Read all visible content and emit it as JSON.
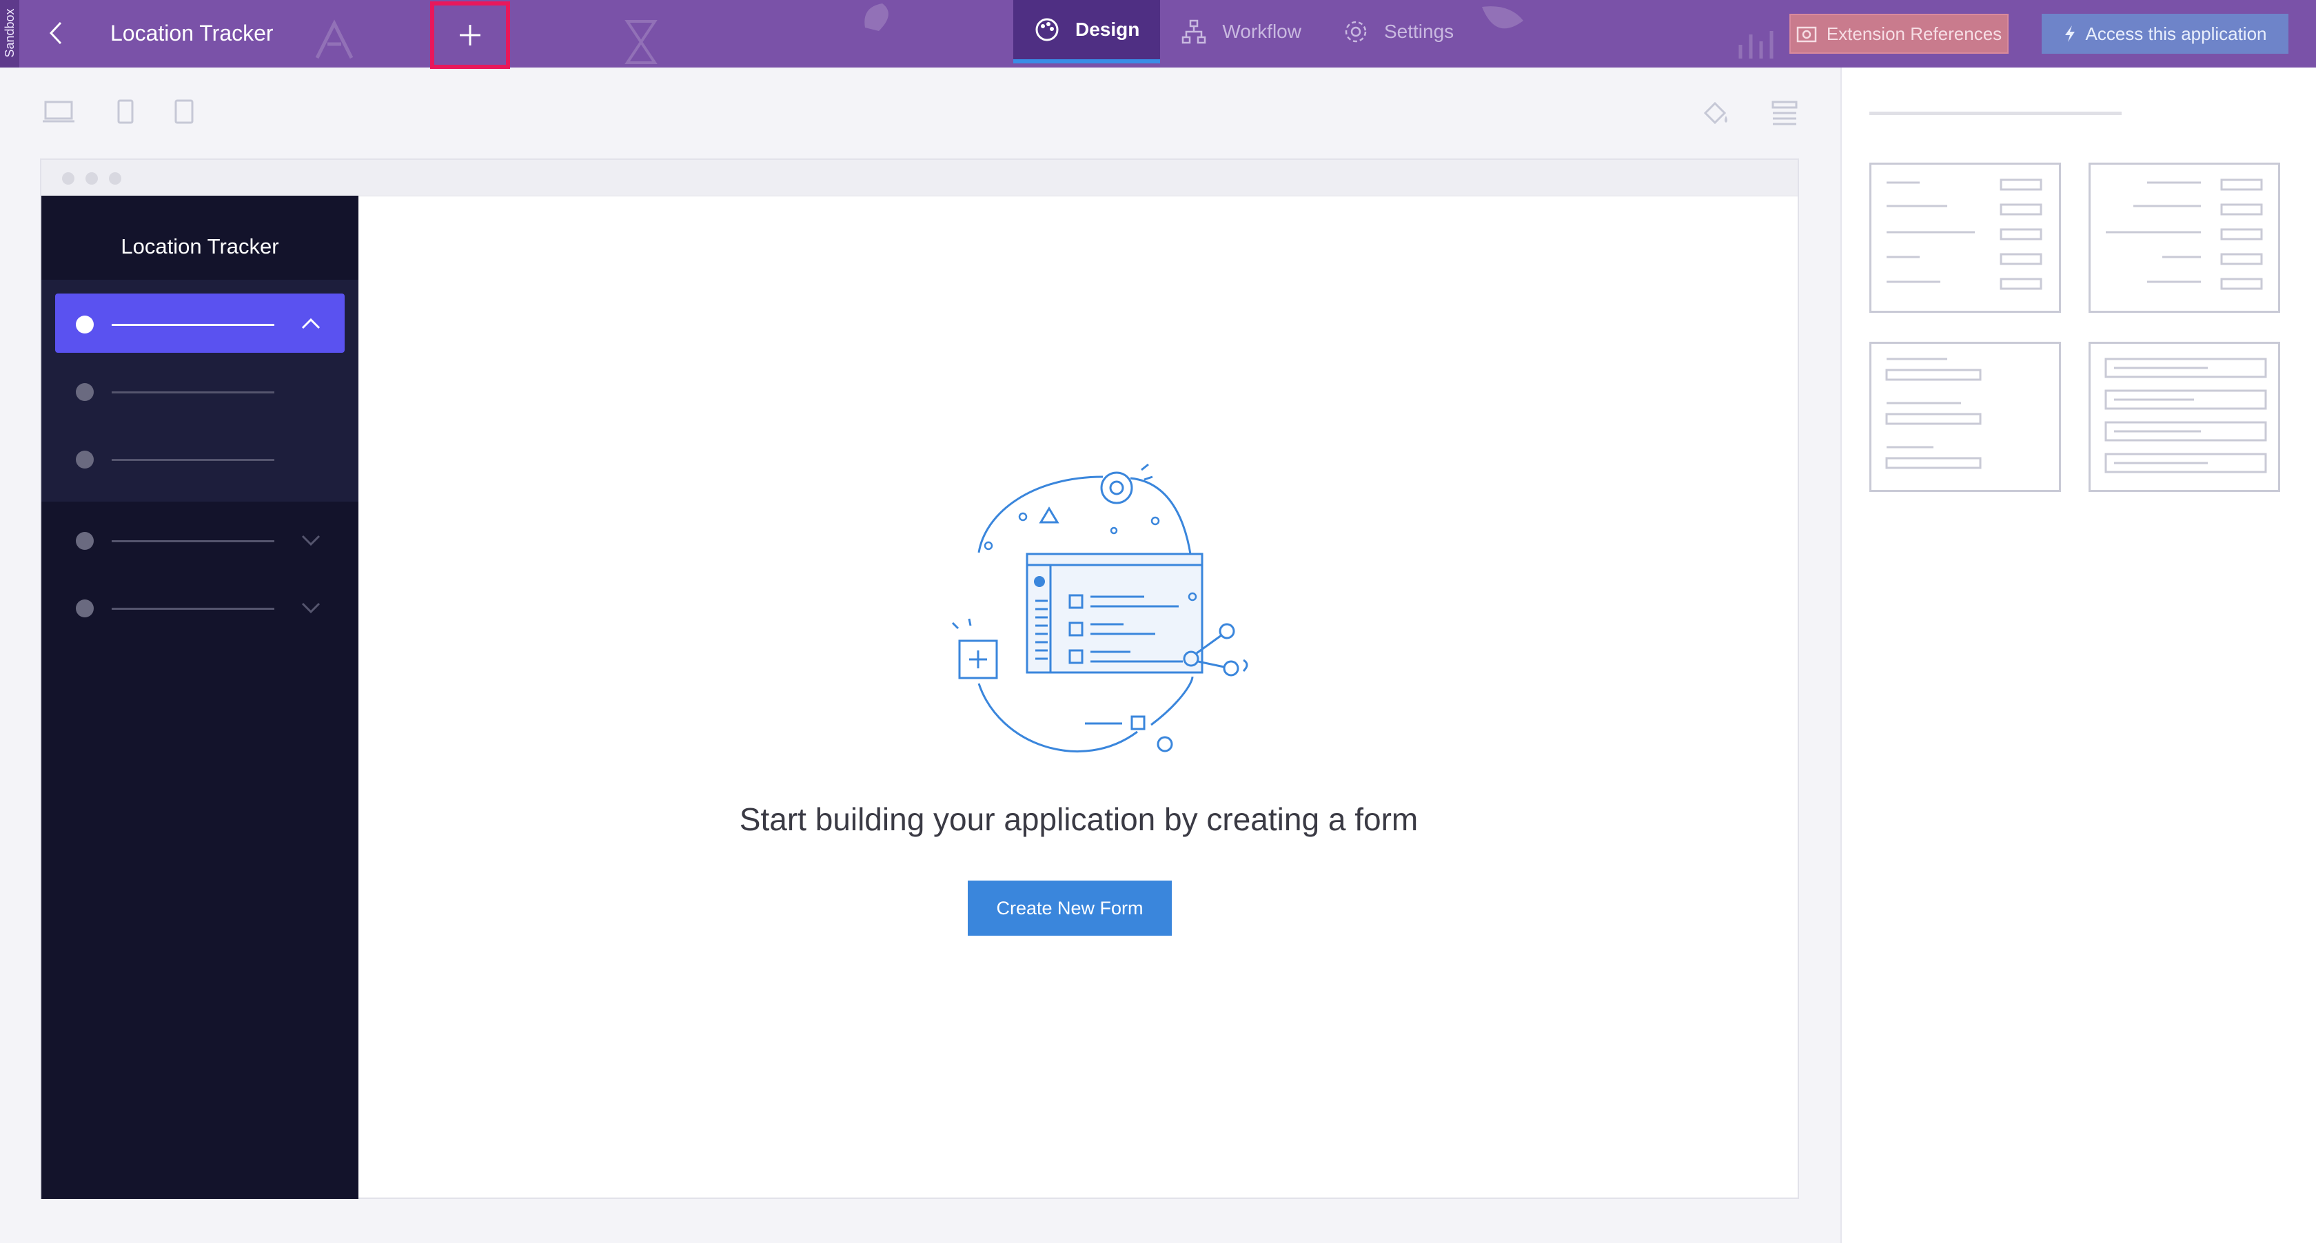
{
  "sandbox_label": "Sandbox",
  "header": {
    "app_title": "Location Tracker",
    "tabs": [
      {
        "label": "Design",
        "icon": "palette-icon",
        "active": true
      },
      {
        "label": "Workflow",
        "icon": "workflow-icon",
        "active": false
      },
      {
        "label": "Settings",
        "icon": "gear-icon",
        "active": false
      }
    ],
    "extension_references_label": "Extension References",
    "access_application_label": "Access this application"
  },
  "toolbar": {
    "devices": [
      "desktop-icon",
      "tablet-icon",
      "mobile-icon"
    ],
    "tools": [
      "paint-bucket-icon",
      "layout-settings-icon"
    ]
  },
  "preview": {
    "nav_title": "Location Tracker",
    "empty_message": "Start building your application by creating a form",
    "create_button_label": "Create New Form"
  },
  "colors": {
    "topbar": "#7a52a8",
    "active_tab": "#4f2f83",
    "highlight_border": "#e8185b",
    "primary_button": "#3a86dc",
    "nav_background": "#13132b",
    "nav_active": "#5a52f0"
  }
}
